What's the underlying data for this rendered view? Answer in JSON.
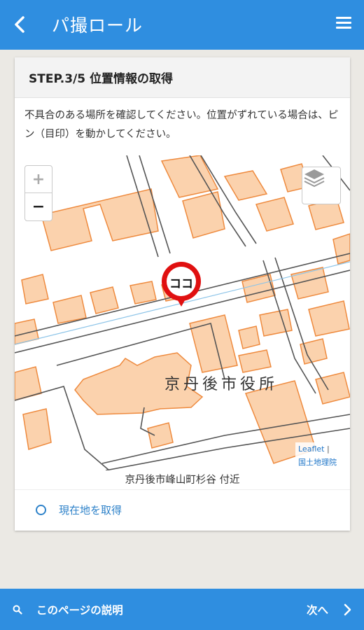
{
  "header": {
    "back_icon": "chevron-left-icon",
    "title": "パ撮ロール",
    "menu_icon": "hamburger-menu-icon"
  },
  "card": {
    "step_title": "STEP.3/5 位置情報の取得",
    "instruction": "不具合のある場所を確認してください。位置がずれている場合は、ピン（目印）を動かしてください。"
  },
  "map": {
    "zoom_in": "+",
    "zoom_out": "−",
    "layers_icon": "layers-icon",
    "landmark_label": "京丹後市役所",
    "pin_label": "ココ",
    "attribution_link": "Leaflet",
    "attribution_separator": "|",
    "attribution_source": "国土地理院",
    "colors": {
      "building_fill": "#fbd2ad",
      "building_stroke": "#ee8a3e",
      "road": "#555555",
      "water": "#8cc4e8",
      "pin": "#e01010"
    }
  },
  "address": "京丹後市峰山町杉谷 付近",
  "locate_label": "現在地を取得",
  "footer": {
    "help_label": "このページの説明",
    "next_label": "次へ"
  },
  "colors": {
    "primary": "#2f8ee0",
    "link": "#2e82c9",
    "background": "#ebe9e4"
  }
}
